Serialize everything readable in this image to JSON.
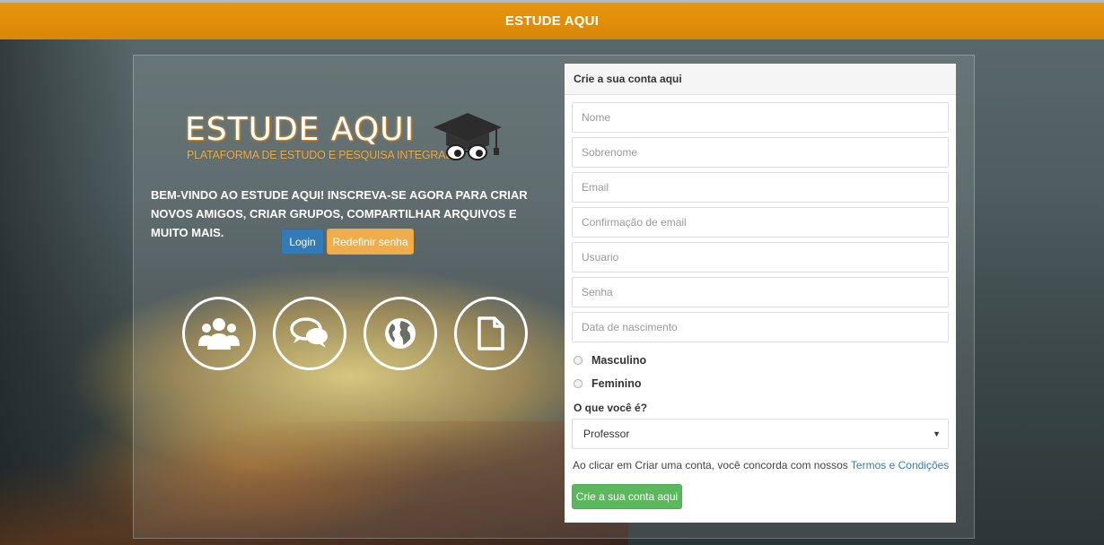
{
  "header": {
    "title": "ESTUDE AQUI"
  },
  "hero": {
    "logo_title": "ESTUDE AQUI",
    "logo_subtitle": "PLATAFORMA DE ESTUDO E PESQUISA INTEGRADA",
    "welcome_text": "BEM-VINDO AO ESTUDE AQUI! INSCREVA-SE AGORA PARA CRIAR NOVOS AMIGOS, CRIAR GRUPOS, COMPARTILHAR ARQUIVOS E MUITO MAIS.",
    "login_label": "Login",
    "reset_label": "Redefinir senha",
    "feature_icons": [
      "users-icon",
      "chat-icon",
      "globe-icon",
      "document-icon"
    ]
  },
  "form": {
    "header": "Crie a sua conta aqui",
    "fields": {
      "nome": "Nome",
      "sobrenome": "Sobrenome",
      "email": "Email",
      "email_confirm": "Confirmação de email",
      "usuario": "Usuario",
      "senha": "Senha",
      "nascimento": "Data de nascimento"
    },
    "gender": {
      "male": "Masculino",
      "female": "Feminino"
    },
    "role_label": "O que você é?",
    "role_selected": "Professor",
    "terms_text": "Ao clicar em Criar uma conta, você concorda com nossos ",
    "terms_link": "Termos e Condições",
    "submit_label": "Crie a sua conta aqui"
  },
  "colors": {
    "topbar": "#e8960c",
    "primary": "#337ab7",
    "warning": "#f0ad4e",
    "success": "#5cb85c"
  }
}
